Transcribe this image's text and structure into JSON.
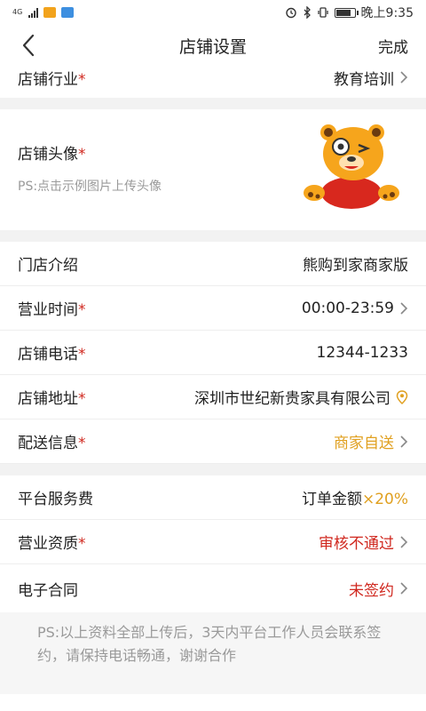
{
  "status_bar": {
    "network": "4G",
    "time": "晚上9:35"
  },
  "nav": {
    "title": "店铺设置",
    "done_label": "完成"
  },
  "industry": {
    "label": "店铺行业",
    "value": "教育培训"
  },
  "avatar": {
    "label": "店铺头像",
    "hint": "PS:点击示例图片上传头像"
  },
  "rows": {
    "intro": {
      "label": "门店介绍",
      "value": "熊购到家商家版"
    },
    "hours": {
      "label": "营业时间",
      "value": "00:00-23:59"
    },
    "phone": {
      "label": "店铺电话",
      "value": "12344-1233"
    },
    "address": {
      "label": "店铺地址",
      "value": "深圳市世纪新贵家具有限公司"
    },
    "delivery": {
      "label": "配送信息",
      "value": "商家自送"
    },
    "fee": {
      "label": "平台服务费",
      "value_prefix": "订单金额",
      "value_highlight": "×20%"
    },
    "qualification": {
      "label": "营业资质",
      "value": "审核不通过"
    },
    "contract": {
      "label": "电子合同",
      "value": "未签约"
    }
  },
  "note": "PS:以上资料全部上传后，3天内平台工作人员会联系签约，请保持电话畅通，谢谢合作",
  "required_mark": "*",
  "colors": {
    "required": "#d0281f",
    "accent_orange": "#e0a020",
    "error_red": "#d0281f",
    "divider_bg": "#f2f2f2"
  },
  "icons": {
    "back": "chevron-left-icon",
    "chevron": "chevron-right-icon",
    "location": "location-pin-icon"
  }
}
